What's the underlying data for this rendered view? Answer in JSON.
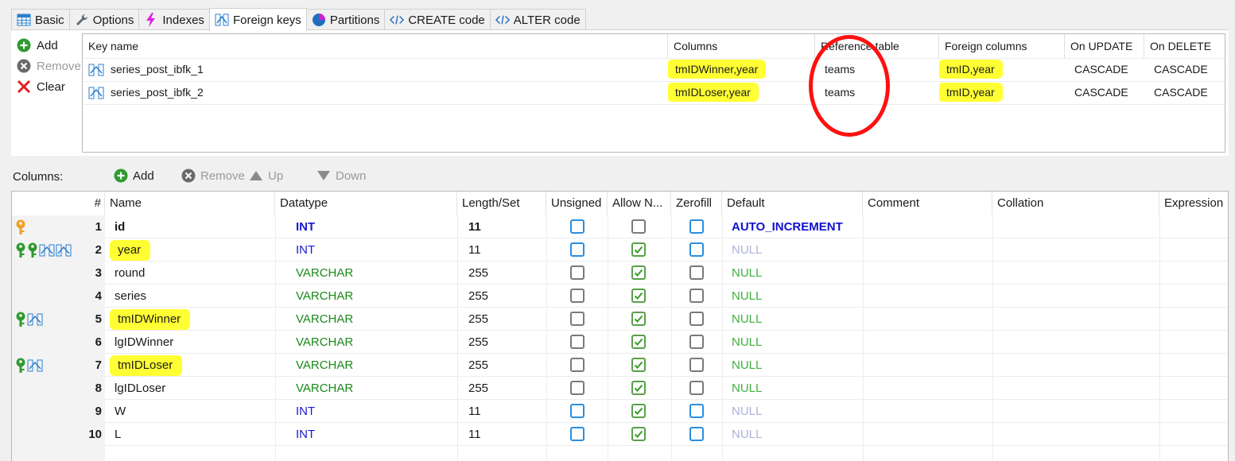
{
  "tabs": [
    {
      "label": "Basic",
      "icon": "table-icon"
    },
    {
      "label": "Options",
      "icon": "wrench-icon"
    },
    {
      "label": "Indexes",
      "icon": "lightning-icon"
    },
    {
      "label": "Foreign keys",
      "icon": "foreign-key-icon"
    },
    {
      "label": "Partitions",
      "icon": "pie-icon"
    },
    {
      "label": "CREATE code",
      "icon": "code-icon"
    },
    {
      "label": "ALTER code",
      "icon": "code-icon"
    }
  ],
  "fk_side": {
    "add": "Add",
    "remove": "Remove",
    "clear": "Clear"
  },
  "fk_headers": [
    "Key name",
    "Columns",
    "Reference table",
    "Foreign columns",
    "On UPDATE",
    "On DELETE"
  ],
  "fk_rows": [
    {
      "key": "series_post_ibfk_1",
      "columns": "tmIDWinner,year",
      "ref_table": "teams",
      "foreign_columns": "tmID,year",
      "on_update": "CASCADE",
      "on_delete": "CASCADE"
    },
    {
      "key": "series_post_ibfk_2",
      "columns": "tmIDLoser,year",
      "ref_table": "teams",
      "foreign_columns": "tmID,year",
      "on_update": "CASCADE",
      "on_delete": "CASCADE"
    }
  ],
  "columns_toolbar": {
    "label": "Columns:",
    "add": "Add",
    "remove": "Remove",
    "up": "Up",
    "down": "Down"
  },
  "col_headers": [
    "#",
    "Name",
    "Datatype",
    "Length/Set",
    "Unsigned",
    "Allow N...",
    "Zerofill",
    "Default",
    "Comment",
    "Collation",
    "Expression"
  ],
  "col_rows": [
    {
      "num": "1",
      "name": "id",
      "type": "INT",
      "length": "11",
      "unsigned": true,
      "allow_null": false,
      "zerofill": false,
      "default": "AUTO_INCREMENT",
      "keys": [
        "primary"
      ]
    },
    {
      "num": "2",
      "name": "year",
      "type": "INT",
      "length": "11",
      "unsigned": true,
      "allow_null": true,
      "zerofill": false,
      "default": "NULL",
      "keys": [
        "index",
        "index",
        "fk",
        "fk"
      ]
    },
    {
      "num": "3",
      "name": "round",
      "type": "VARCHAR",
      "length": "255",
      "unsigned": false,
      "allow_null": true,
      "zerofill": false,
      "default": "NULL",
      "keys": []
    },
    {
      "num": "4",
      "name": "series",
      "type": "VARCHAR",
      "length": "255",
      "unsigned": false,
      "allow_null": true,
      "zerofill": false,
      "default": "NULL",
      "keys": []
    },
    {
      "num": "5",
      "name": "tmIDWinner",
      "type": "VARCHAR",
      "length": "255",
      "unsigned": false,
      "allow_null": true,
      "zerofill": false,
      "default": "NULL",
      "keys": [
        "index",
        "fk"
      ]
    },
    {
      "num": "6",
      "name": "lgIDWinner",
      "type": "VARCHAR",
      "length": "255",
      "unsigned": false,
      "allow_null": true,
      "zerofill": false,
      "default": "NULL",
      "keys": []
    },
    {
      "num": "7",
      "name": "tmIDLoser",
      "type": "VARCHAR",
      "length": "255",
      "unsigned": false,
      "allow_null": true,
      "zerofill": false,
      "default": "NULL",
      "keys": [
        "index",
        "fk"
      ]
    },
    {
      "num": "8",
      "name": "lgIDLoser",
      "type": "VARCHAR",
      "length": "255",
      "unsigned": false,
      "allow_null": true,
      "zerofill": false,
      "default": "NULL",
      "keys": []
    },
    {
      "num": "9",
      "name": "W",
      "type": "INT",
      "length": "11",
      "unsigned": true,
      "allow_null": true,
      "zerofill": false,
      "default": "NULL",
      "keys": []
    },
    {
      "num": "10",
      "name": "L",
      "type": "INT",
      "length": "11",
      "unsigned": true,
      "allow_null": true,
      "zerofill": false,
      "default": "NULL",
      "keys": []
    }
  ],
  "colors": {
    "highlight": "#ffff33",
    "annotation_circle": "#ff1010",
    "int_type": "#1a1ad0",
    "varchar_type": "#1a8a1a"
  }
}
